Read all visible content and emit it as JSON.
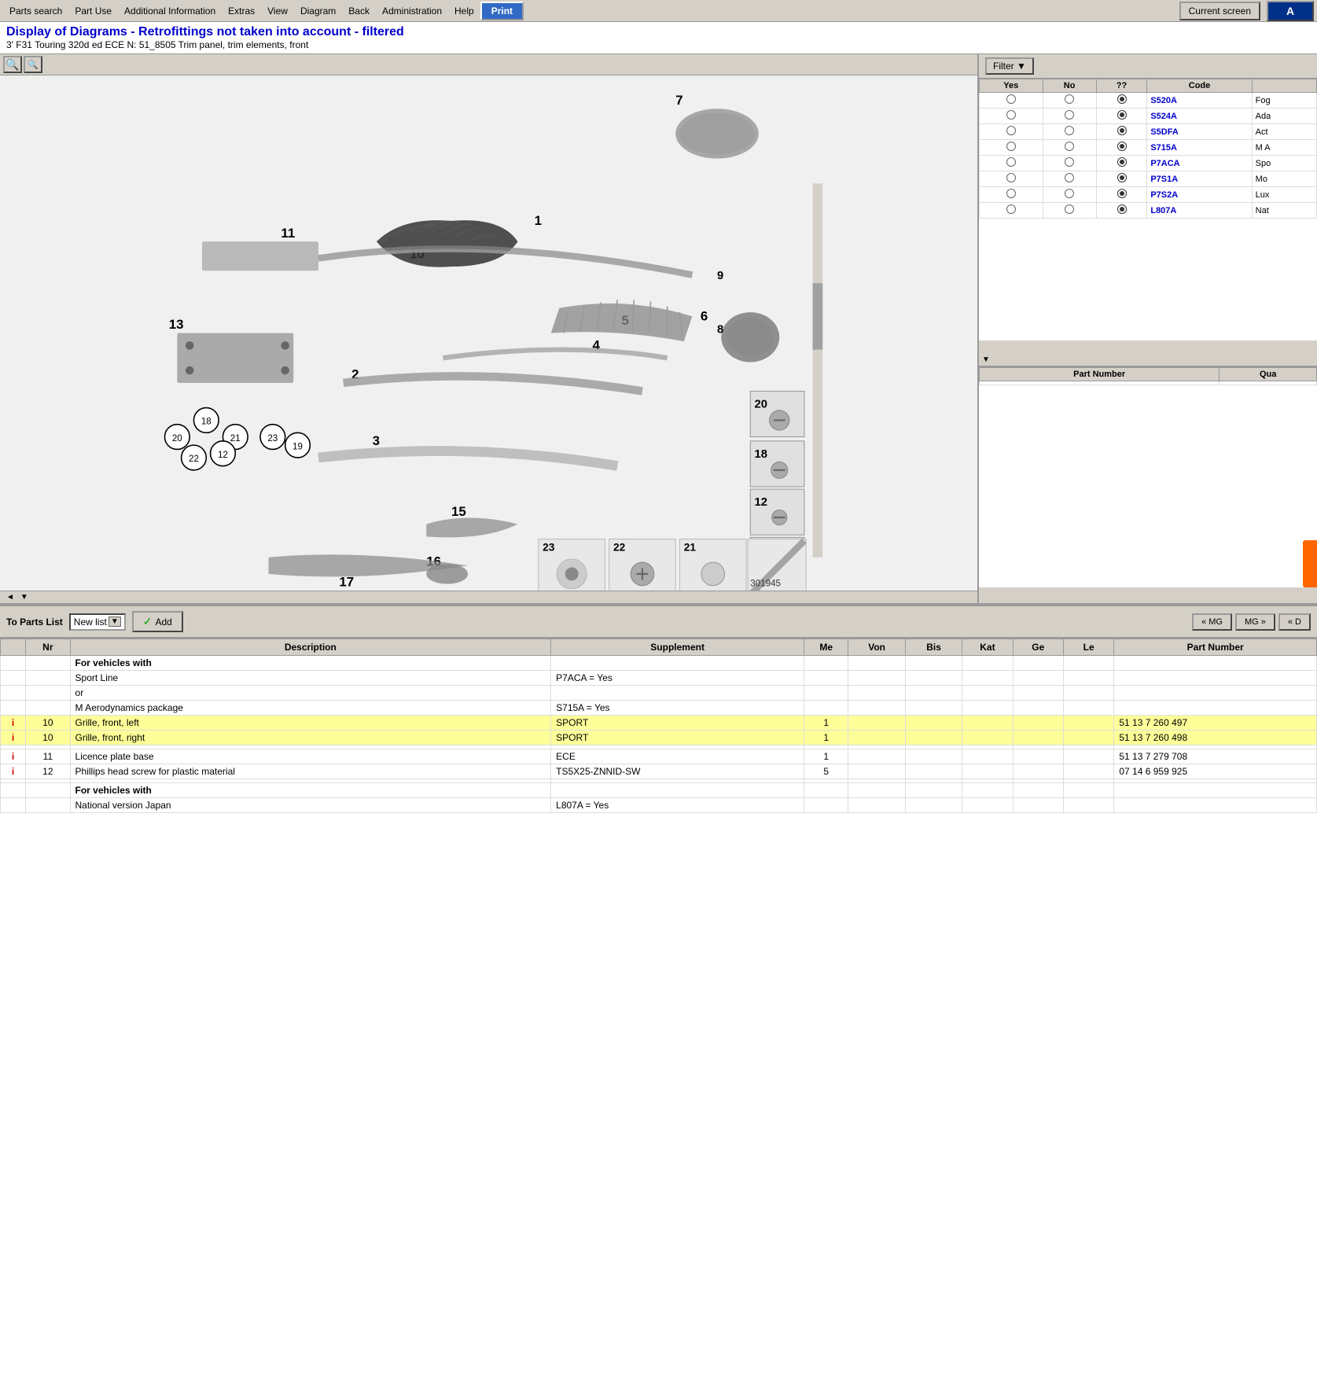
{
  "menubar": {
    "items": [
      {
        "label": "Parts search",
        "active": false
      },
      {
        "label": "Part Use",
        "active": false
      },
      {
        "label": "Additional Information",
        "active": false
      },
      {
        "label": "Extras",
        "active": false
      },
      {
        "label": "View",
        "active": false
      },
      {
        "label": "Diagram",
        "active": false
      },
      {
        "label": "Back",
        "active": false
      },
      {
        "label": "Administration",
        "active": false
      },
      {
        "label": "Help",
        "active": false
      },
      {
        "label": "Print",
        "active": true
      }
    ],
    "current_screen": "Current screen"
  },
  "title": {
    "main": "Display of Diagrams - Retrofittings not taken into account - filtered",
    "sub": "3' F31 Touring 320d ed ECE  N: 51_8505 Trim panel, trim elements, front"
  },
  "diagram": {
    "zoom_in": "🔍+",
    "zoom_out": "🔍-",
    "image_ref_number": "301945"
  },
  "filter": {
    "label": "Filter ▼",
    "columns": [
      "Yes",
      "No",
      "??",
      "Code"
    ],
    "rows": [
      {
        "yes": false,
        "no": false,
        "maybe": true,
        "code": "S520A",
        "desc": "Fog"
      },
      {
        "yes": false,
        "no": false,
        "maybe": true,
        "code": "S524A",
        "desc": "Ada"
      },
      {
        "yes": false,
        "no": false,
        "maybe": true,
        "code": "S5DFA",
        "desc": "Act"
      },
      {
        "yes": false,
        "no": false,
        "maybe": true,
        "code": "S715A",
        "desc": "M A"
      },
      {
        "yes": false,
        "no": false,
        "maybe": true,
        "code": "P7ACA",
        "desc": "Spo"
      },
      {
        "yes": false,
        "no": false,
        "maybe": true,
        "code": "P7S1A",
        "desc": "Mo"
      },
      {
        "yes": false,
        "no": false,
        "maybe": true,
        "code": "P7S2A",
        "desc": "Lux"
      },
      {
        "yes": false,
        "no": false,
        "maybe": true,
        "code": "L807A",
        "desc": "Nat"
      }
    ]
  },
  "parts_panel": {
    "columns": [
      "Part Number",
      "Qua"
    ]
  },
  "bottom_toolbar": {
    "to_parts_list": "To Parts List",
    "new_list": "New list",
    "add_label": "Add",
    "nav_buttons": [
      "« MG",
      "MG »",
      "« D"
    ]
  },
  "data_table": {
    "columns": [
      "",
      "Nr",
      "Description",
      "Supplement",
      "Me",
      "Von",
      "Bis",
      "Kat",
      "Ge",
      "Le",
      "Part Number"
    ],
    "rows": [
      {
        "info": "",
        "nr": "",
        "desc": "For vehicles with",
        "supplement": "",
        "me": "",
        "von": "",
        "bis": "",
        "kat": "",
        "ge": "",
        "le": "",
        "part": "",
        "bold": true,
        "yellow": false
      },
      {
        "info": "",
        "nr": "",
        "desc": "Sport Line",
        "supplement": "P7ACA = Yes",
        "me": "",
        "von": "",
        "bis": "",
        "kat": "",
        "ge": "",
        "le": "",
        "part": "",
        "bold": false,
        "yellow": false
      },
      {
        "info": "",
        "nr": "",
        "desc": "or",
        "supplement": "",
        "me": "",
        "von": "",
        "bis": "",
        "kat": "",
        "ge": "",
        "le": "",
        "part": "",
        "bold": false,
        "yellow": false
      },
      {
        "info": "",
        "nr": "",
        "desc": "M Aerodynamics package",
        "supplement": "S715A = Yes",
        "me": "",
        "von": "",
        "bis": "",
        "kat": "",
        "ge": "",
        "le": "",
        "part": "",
        "bold": false,
        "yellow": false
      },
      {
        "info": "i",
        "nr": "10",
        "desc": "Grille, front, left",
        "supplement": "SPORT",
        "me": "1",
        "von": "",
        "bis": "",
        "kat": "",
        "ge": "",
        "le": "",
        "part": "51 13 7 260 497",
        "bold": false,
        "yellow": true
      },
      {
        "info": "i",
        "nr": "10",
        "desc": "Grille, front, right",
        "supplement": "SPORT",
        "me": "1",
        "von": "",
        "bis": "",
        "kat": "",
        "ge": "",
        "le": "",
        "part": "51 13 7 260 498",
        "bold": false,
        "yellow": true
      },
      {
        "info": "",
        "nr": "",
        "desc": "",
        "supplement": "",
        "me": "",
        "von": "",
        "bis": "",
        "kat": "",
        "ge": "",
        "le": "",
        "part": "",
        "bold": false,
        "yellow": false
      },
      {
        "info": "i",
        "nr": "11",
        "desc": "Licence plate base",
        "supplement": "ECE",
        "me": "1",
        "von": "",
        "bis": "",
        "kat": "",
        "ge": "",
        "le": "",
        "part": "51 13 7 279 708",
        "bold": false,
        "yellow": false
      },
      {
        "info": "i",
        "nr": "12",
        "desc": "Phillips head screw for plastic material",
        "supplement": "TS5X25-ZNNID-SW",
        "me": "5",
        "von": "",
        "bis": "",
        "kat": "",
        "ge": "",
        "le": "",
        "part": "07 14 6 959 925",
        "bold": false,
        "yellow": false
      },
      {
        "info": "",
        "nr": "",
        "desc": "",
        "supplement": "",
        "me": "",
        "von": "",
        "bis": "",
        "kat": "",
        "ge": "",
        "le": "",
        "part": "",
        "bold": false,
        "yellow": false
      },
      {
        "info": "",
        "nr": "",
        "desc": "For vehicles with",
        "supplement": "",
        "me": "",
        "von": "",
        "bis": "",
        "kat": "",
        "ge": "",
        "le": "",
        "part": "",
        "bold": true,
        "yellow": false
      },
      {
        "info": "",
        "nr": "",
        "desc": "National version Japan",
        "supplement": "L807A = Yes",
        "me": "",
        "von": "",
        "bis": "",
        "kat": "",
        "ge": "",
        "le": "",
        "part": "",
        "bold": false,
        "yellow": false
      }
    ]
  }
}
